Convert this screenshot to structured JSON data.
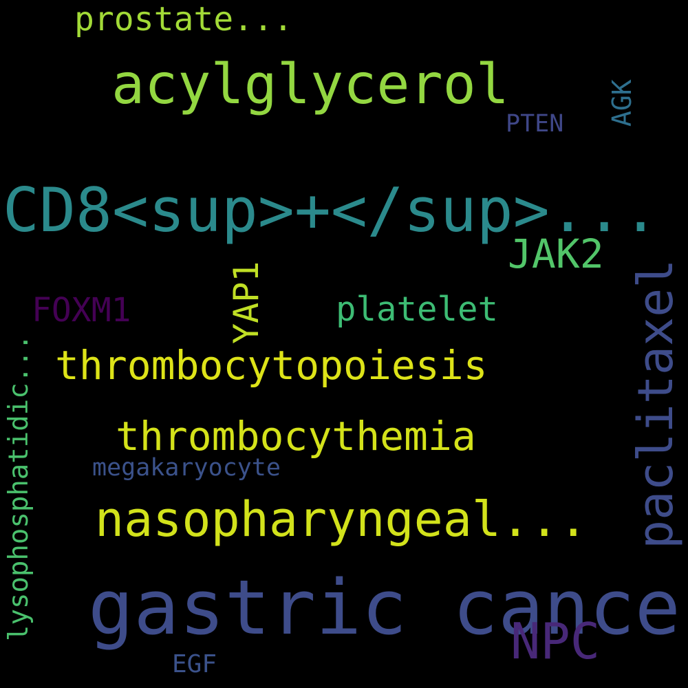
{
  "words": {
    "gastric_cancer": {
      "text": "gastric cancer",
      "color": "#3e4c8a"
    },
    "cd8": {
      "text": "CD8<sup>+</sup>...",
      "color": "#2b8a8c"
    },
    "acylglycerol": {
      "text": "acylglycerol",
      "color": "#93d741"
    },
    "nasopharyngeal": {
      "text": "nasopharyngeal...",
      "color": "#d2e21b"
    },
    "thrombocytopoiesis": {
      "text": "thrombocytopoiesis",
      "color": "#dde318"
    },
    "thrombocythemia": {
      "text": "thrombocythemia",
      "color": "#d4e21a"
    },
    "npc": {
      "text": "NPC",
      "color": "#482878"
    },
    "jak2": {
      "text": "JAK2",
      "color": "#52c569"
    },
    "prostate": {
      "text": "prostate...",
      "color": "#a2da37"
    },
    "platelet": {
      "text": "platelet",
      "color": "#3dbc74"
    },
    "foxm1": {
      "text": "FOXM1",
      "color": "#440154"
    },
    "megakaryocyte": {
      "text": "megakaryocyte",
      "color": "#3b528b"
    },
    "pten": {
      "text": "PTEN",
      "color": "#3f4788"
    },
    "egf": {
      "text": "EGF",
      "color": "#3b528b"
    },
    "yap1": {
      "text": "YAP1",
      "color": "#c0df25"
    },
    "paclitaxel": {
      "text": "paclitaxel",
      "color": "#3e4c8a"
    },
    "lysophosphatidic": {
      "text": "lysophosphatidic...",
      "color": "#4ac16d"
    },
    "agk": {
      "text": "AGK",
      "color": "#2e6f8e"
    }
  }
}
